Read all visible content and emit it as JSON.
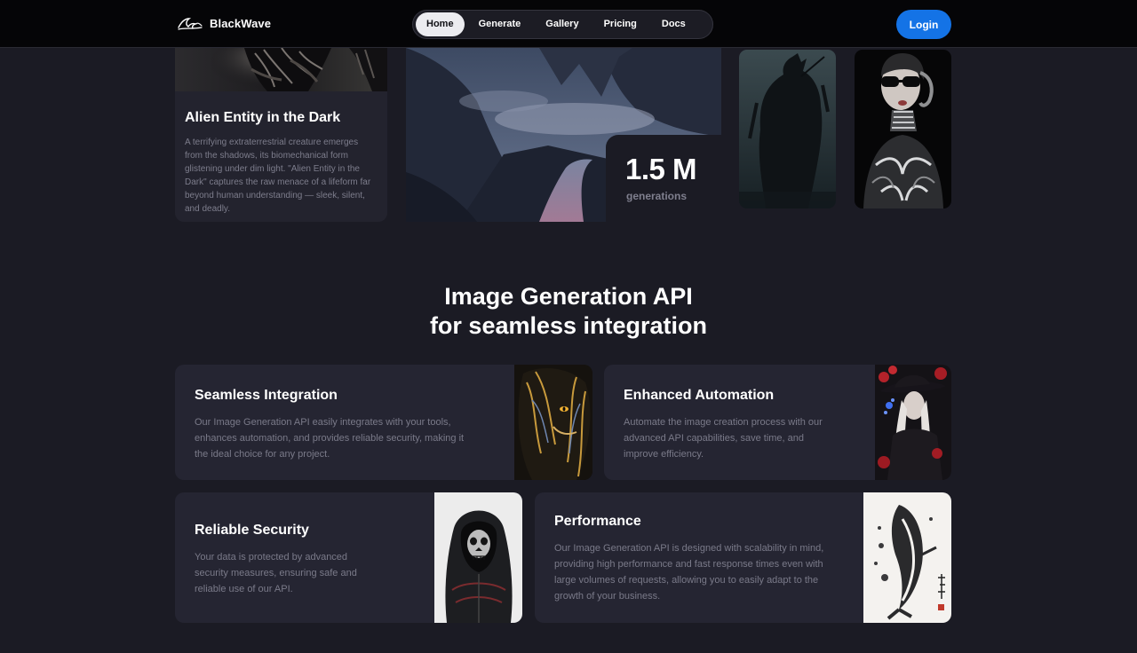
{
  "nav": {
    "brand": "BlackWave",
    "brand_icon": "wave-logo-icon",
    "links": [
      "Home",
      "Generate",
      "Gallery",
      "Pricing",
      "Docs"
    ],
    "active_link": "Home",
    "login_label": "Login",
    "login_color": "#1473e6"
  },
  "gallery": {
    "featured": {
      "title": "Alien Entity in the Dark",
      "description": "A terrifying extraterrestrial creature emerges from the shadows, its biomechanical form glistening under dim light. \"Alien Entity in the Dark\" captures the raw menace of a lifeform far beyond human understanding — sleek, silent, and deadly."
    },
    "stat": {
      "value": "1.5 M",
      "label": "generations"
    }
  },
  "api_section": {
    "title_line1": "Image Generation API",
    "title_line2": "for seamless integration",
    "features": [
      {
        "title": "Seamless Integration",
        "description": "Our Image Generation API easily integrates with your tools, enhances automation, and provides reliable security, making it the ideal choice for any project."
      },
      {
        "title": "Enhanced Automation",
        "description": "Automate the image creation process with our advanced API capabilities, save time, and improve efficiency."
      },
      {
        "title": "Reliable Security",
        "description": "Your data is protected by advanced security measures, ensuring safe and reliable use of our API."
      },
      {
        "title": "Performance",
        "description": "Our Image Generation API is designed with scalability in mind, providing high performance and fast response times even with large volumes of requests, allowing you to easily adapt to the growth of your business."
      }
    ]
  },
  "colors": {
    "background": "#1b1b24",
    "card": "#252532",
    "nav_background": "#050507",
    "muted_text": "#7a7a89"
  }
}
